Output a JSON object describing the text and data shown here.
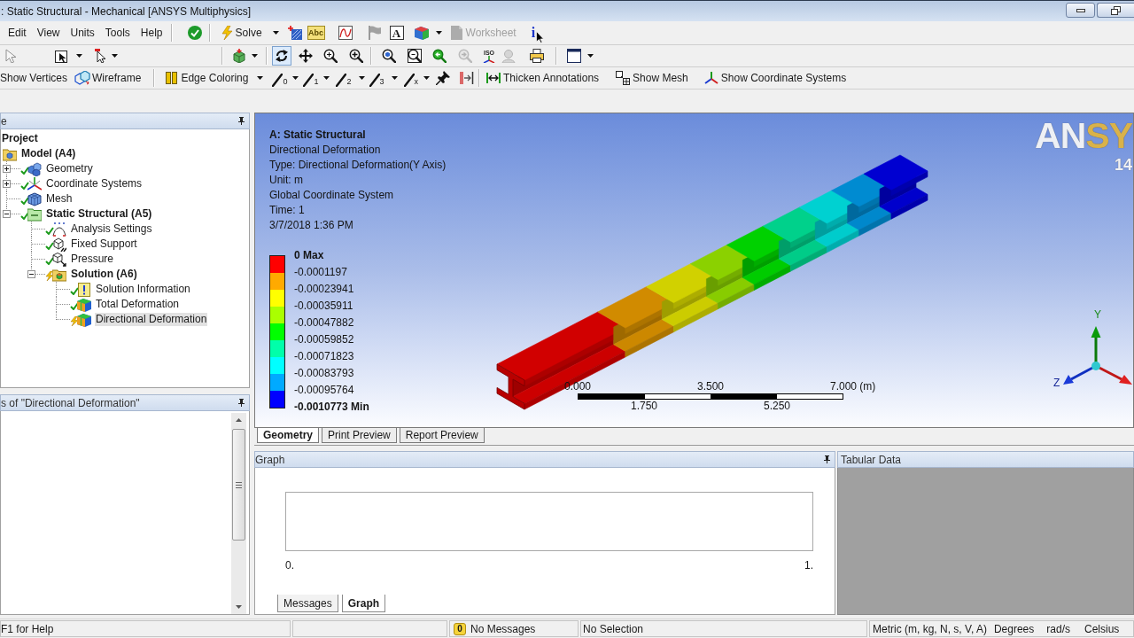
{
  "window": {
    "title": ": Static Structural - Mechanical [ANSYS Multiphysics]"
  },
  "menu": [
    {
      "label": "Edit"
    },
    {
      "label": "View"
    },
    {
      "label": "Units"
    },
    {
      "label": "Tools"
    },
    {
      "label": "Help"
    }
  ],
  "main_toolbar": {
    "solve": {
      "label": "Solve"
    },
    "tools": [
      {
        "disabled": false
      },
      {
        "label": "Abc",
        "disabled": false
      },
      {
        "disabled": false
      },
      {
        "disabled": true
      },
      {
        "label": "A",
        "disabled": false
      },
      {
        "disabled": false
      }
    ],
    "worksheet": {
      "label": "Worksheet",
      "disabled": true
    },
    "info": {
      "label": "i"
    }
  },
  "graphics_toolbar": {
    "tools": [
      {
        "disabled": true,
        "pressed": false
      },
      {
        "disabled": false,
        "pressed": false
      },
      {
        "disabled": false,
        "pressed": false
      },
      {
        "disabled": false,
        "pressed": false
      },
      {
        "disabled": false,
        "pressed": true
      },
      {
        "disabled": false,
        "pressed": false
      },
      {
        "disabled": false,
        "pressed": false
      },
      {
        "disabled": false,
        "pressed": false
      },
      {
        "disabled": false,
        "pressed": false
      },
      {
        "disabled": false,
        "pressed": false
      },
      {
        "disabled": false,
        "pressed": false
      },
      {
        "disabled": true,
        "pressed": false
      },
      {
        "label": "ISO",
        "disabled": false,
        "pressed": false
      },
      {
        "disabled": true,
        "pressed": false
      },
      {
        "disabled": false,
        "pressed": false
      },
      {
        "disabled": false,
        "pressed": false
      }
    ]
  },
  "display_toolbar": {
    "show_vertices": {
      "label": "Show Vertices"
    },
    "wireframe": {
      "label": "Wireframe"
    },
    "edge_coloring": {
      "label": "Edge Coloring"
    },
    "edge_styles": [
      {
        "label": "0"
      },
      {
        "label": "1"
      },
      {
        "label": "2"
      },
      {
        "label": "3"
      },
      {
        "label": "x"
      }
    ],
    "thicken_annotations": {
      "label": "Thicken Annotations"
    },
    "show_mesh": {
      "label": "Show Mesh"
    },
    "show_coordinate_systems": {
      "label": "Show Coordinate Systems"
    }
  },
  "outline": {
    "header": "e",
    "tree": [
      {
        "label": "Project",
        "kind": "project",
        "selected": false,
        "children": [
          {
            "label": "Model (A4)",
            "kind": "model",
            "selected": false,
            "children": [
              {
                "label": "Geometry",
                "kind": "geometry",
                "solved": true,
                "expanded": false,
                "selected": false
              },
              {
                "label": "Coordinate Systems",
                "kind": "coordinate_systems",
                "solved": true,
                "expanded": false,
                "selected": false
              },
              {
                "label": "Mesh",
                "kind": "mesh",
                "solved": true,
                "selected": false
              },
              {
                "label": "Static Structural (A5)",
                "kind": "analysis",
                "solved": true,
                "expanded": true,
                "selected": false,
                "children": [
                  {
                    "label": "Analysis Settings",
                    "kind": "analysis_settings",
                    "solved": true,
                    "selected": false
                  },
                  {
                    "label": "Fixed Support",
                    "kind": "support",
                    "solved": true,
                    "selected": false
                  },
                  {
                    "label": "Pressure",
                    "kind": "load",
                    "solved": true,
                    "selected": false
                  },
                  {
                    "label": "Solution (A6)",
                    "kind": "solution",
                    "solved": false,
                    "expanded": true,
                    "selected": false,
                    "children": [
                      {
                        "label": "Solution Information",
                        "kind": "solution_information",
                        "solved": true,
                        "selected": false
                      },
                      {
                        "label": "Total Deformation",
                        "kind": "result",
                        "solved": true,
                        "selected": false
                      },
                      {
                        "label": "Directional Deformation",
                        "kind": "result",
                        "solved": false,
                        "selected": true
                      }
                    ]
                  }
                ]
              }
            ]
          }
        ]
      }
    ]
  },
  "details": {
    "header": "s of \"Directional Deformation\""
  },
  "viewport": {
    "info": {
      "title": "A: Static Structural",
      "lines": [
        "Directional Deformation",
        "Type: Directional Deformation(Y Axis)",
        "Unit: m",
        "Global Coordinate System",
        "Time: 1",
        "3/7/2018 1:36 PM"
      ]
    },
    "legend": {
      "labels": [
        {
          "kind": "max",
          "text": "0 Max"
        },
        {
          "kind": "value",
          "text": "-0.0001197"
        },
        {
          "kind": "value",
          "text": "-0.00023941"
        },
        {
          "kind": "value",
          "text": "-0.00035911"
        },
        {
          "kind": "value",
          "text": "-0.00047882"
        },
        {
          "kind": "value",
          "text": "-0.00059852"
        },
        {
          "kind": "value",
          "text": "-0.00071823"
        },
        {
          "kind": "value",
          "text": "-0.00083793"
        },
        {
          "kind": "value",
          "text": "-0.00095764"
        },
        {
          "kind": "min",
          "text": "-0.0010773 Min"
        }
      ],
      "bands": [
        {
          "color": "#ff0000"
        },
        {
          "color": "#ffaa00"
        },
        {
          "color": "#ffff00"
        },
        {
          "color": "#aaff00"
        },
        {
          "color": "#00ff00"
        },
        {
          "color": "#00ffaa"
        },
        {
          "color": "#00ffff"
        },
        {
          "color": "#00aaff"
        },
        {
          "color": "#0000ff"
        }
      ]
    },
    "scale_bar": {
      "top_labels": [
        "0.000",
        "3.500",
        "7.000 (m)"
      ],
      "bottom_labels": [
        "1.750",
        "5.250"
      ]
    },
    "triad": {
      "labels": [
        "Y",
        "Z"
      ]
    },
    "logo": {
      "text": "ANSY",
      "version": "14"
    }
  },
  "view_tabs": [
    {
      "label": "Geometry",
      "selected": true
    },
    {
      "label": "Print Preview",
      "selected": false
    },
    {
      "label": "Report Preview",
      "selected": false
    }
  ],
  "graph_panel": {
    "title": "Graph",
    "axis_labels": [
      "0.",
      "1."
    ],
    "tabs": [
      {
        "label": "Messages",
        "selected": false
      },
      {
        "label": "Graph",
        "selected": true
      }
    ]
  },
  "tabular_panel": {
    "title": "Tabular Data"
  },
  "status_bar": {
    "help": "F1 for Help",
    "messages": {
      "count": "0",
      "label": "No Messages"
    },
    "selection": "No Selection",
    "units": "Metric (m, kg, N, s, V, A)",
    "angle": "Degrees",
    "rotational_velocity": "rad/s",
    "temperature": "Celsius"
  }
}
